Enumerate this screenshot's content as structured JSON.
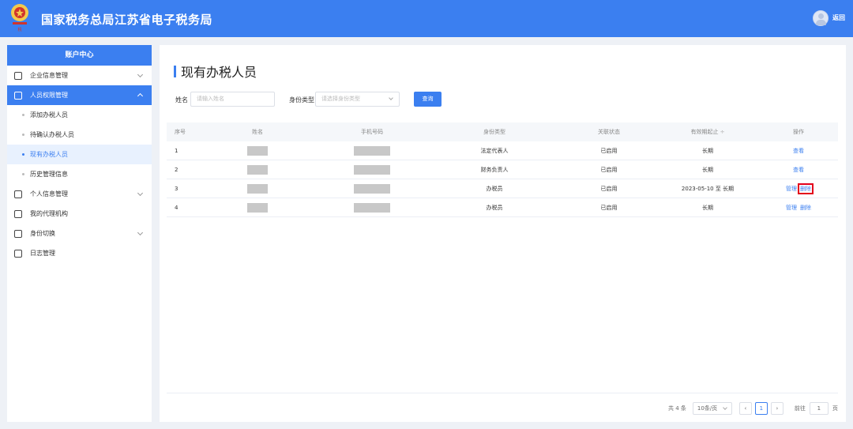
{
  "header": {
    "title": "国家税务总局江苏省电子税务局",
    "back_label": "返回"
  },
  "sidebar": {
    "title": "账户中心",
    "items": [
      {
        "label": "企业信息管理"
      },
      {
        "label": "人员权限管理"
      },
      {
        "label": "个人信息管理"
      },
      {
        "label": "我的代理机构"
      },
      {
        "label": "身份切换"
      },
      {
        "label": "日志管理"
      }
    ],
    "subitems": [
      {
        "label": "添加办税人员"
      },
      {
        "label": "待确认办税人员"
      },
      {
        "label": "现有办税人员"
      },
      {
        "label": "历史管理信息"
      }
    ]
  },
  "main": {
    "title": "现有办税人员",
    "filters": {
      "name_label": "姓名",
      "name_placeholder": "请输入姓名",
      "type_label": "身份类型",
      "type_placeholder": "请选择身份类型",
      "query_label": "查询"
    },
    "table": {
      "headers": [
        "序号",
        "姓名",
        "手机号码",
        "身份类型",
        "关联状态",
        "有效期起止",
        "操作"
      ],
      "sort_icon": "÷",
      "rows": [
        {
          "index": "1",
          "type": "法定代表人",
          "status": "已启用",
          "period": "长期",
          "actions": [
            "查看"
          ]
        },
        {
          "index": "2",
          "type": "财务负责人",
          "status": "已启用",
          "period": "长期",
          "actions": [
            "查看"
          ]
        },
        {
          "index": "3",
          "type": "办税员",
          "status": "已启用",
          "period": "2023-05-10 至 长期",
          "actions": [
            "管理",
            "删除"
          ]
        },
        {
          "index": "4",
          "type": "办税员",
          "status": "已启用",
          "period": "长期",
          "actions": [
            "管理",
            "删除"
          ]
        }
      ]
    },
    "pagination": {
      "total": "共 4 条",
      "page_size": "10条/页",
      "current_page": "1",
      "goto_label": "前往",
      "goto_value": "1",
      "page_unit": "页"
    }
  },
  "colors": {
    "accent": "#3b7ff0",
    "highlight": "#e3001b"
  }
}
